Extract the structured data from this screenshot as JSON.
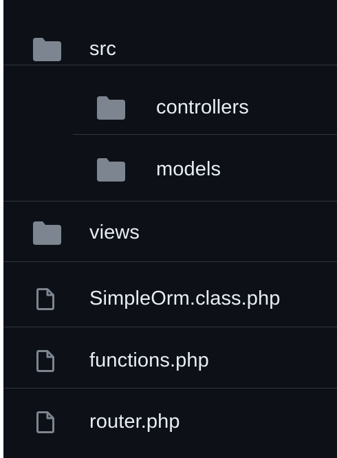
{
  "file_tree": {
    "items": [
      {
        "type": "folder",
        "label": "src",
        "icon": "folder-icon",
        "depth": 0
      },
      {
        "type": "folder",
        "label": "controllers",
        "icon": "folder-icon",
        "depth": 1
      },
      {
        "type": "folder",
        "label": "models",
        "icon": "folder-icon",
        "depth": 1
      },
      {
        "type": "folder",
        "label": "views",
        "icon": "folder-icon",
        "depth": 0
      },
      {
        "type": "file",
        "label": "SimpleOrm.class.php",
        "icon": "file-icon",
        "depth": 0
      },
      {
        "type": "file",
        "label": "functions.php",
        "icon": "file-icon",
        "depth": 0
      },
      {
        "type": "file",
        "label": "router.php",
        "icon": "file-icon",
        "depth": 0
      }
    ]
  },
  "colors": {
    "background": "#0d1117",
    "text": "#e6edf3",
    "folder_icon": "#7d8590",
    "file_icon": "#7d8590",
    "divider": "#30363d"
  }
}
